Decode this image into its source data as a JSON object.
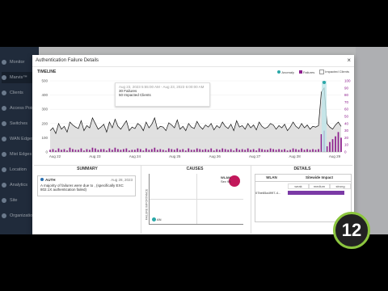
{
  "sidebar": {
    "items": [
      {
        "label": "Monitor"
      },
      {
        "label": "Marvis™"
      },
      {
        "label": "Clients"
      },
      {
        "label": "Access Points"
      },
      {
        "label": "Switches"
      },
      {
        "label": "WAN Edges"
      },
      {
        "label": "Mist Edges"
      },
      {
        "label": "Location"
      },
      {
        "label": "Analytics"
      },
      {
        "label": "Site"
      },
      {
        "label": "Organization"
      }
    ],
    "badge": "1"
  },
  "modal": {
    "title": "Authentication Failure Details",
    "close": "×"
  },
  "timeline": {
    "title": "TIMELINE",
    "legend": {
      "anomaly": "Anomaly",
      "failures": "Failures",
      "impacted": "Impacted Clients"
    },
    "tooltip": {
      "time": "Aug 23, 2023 5:55:00 AM - Aug 23, 2023 6:00:00 AM",
      "failures": "30 Failures",
      "clients": "50 Impacted Clients"
    }
  },
  "summary": {
    "title": "SUMMARY",
    "card_label": "AUTH",
    "card_date": "Aug 28, 2023",
    "card_text": "A majority of failures were due to , (specifically EXC 802.1X authentication failed)"
  },
  "causes": {
    "title": "CAUSES",
    "wlan_label": "WLAN",
    "wlan_value": "Sev 95",
    "axis_label": "FAILURE IMPORTANCE",
    "small_label": "AN"
  },
  "details": {
    "title": "DETAILS",
    "col_wlan": "WLAN",
    "col_impact": "Sitewide Impact",
    "sub_weak": "weak",
    "sub_medium": "medium",
    "sub_strong": "strong",
    "row_name": "07be65a4997-4..."
  },
  "player": {
    "badge": "12"
  },
  "colors": {
    "failures": "#8e1f8e",
    "impacted": "#d8d8d8",
    "anomaly": "#2aa7a7",
    "line": "#111111",
    "accent": "#7b3aa6"
  },
  "chart_data": {
    "type": "line",
    "title": "TIMELINE",
    "x_ticks": [
      "Aug 22",
      "Aug 23",
      "Aug 24",
      "Aug 25",
      "Aug 26",
      "Aug 27",
      "Aug 28",
      "Aug 29"
    ],
    "y_left_ticks": [
      0,
      100,
      200,
      300,
      400,
      500
    ],
    "y_right_ticks": [
      0,
      10,
      20,
      30,
      40,
      50,
      60,
      70,
      80,
      90,
      100
    ],
    "ylim_left": [
      0,
      500
    ],
    "ylim_right": [
      0,
      100
    ],
    "series": [
      {
        "name": "Impacted Clients",
        "axis": "left",
        "values": [
          150,
          170,
          130,
          200,
          160,
          180,
          140,
          210,
          190,
          175,
          165,
          220,
          150,
          185,
          170,
          240,
          200,
          160,
          175,
          195,
          140,
          210,
          170,
          230,
          180,
          160,
          190,
          220,
          150,
          175,
          165,
          200,
          185,
          150,
          210,
          170,
          195,
          240,
          160,
          180,
          175,
          150,
          205,
          190,
          170,
          225,
          160,
          180,
          150,
          200,
          175,
          165,
          215,
          180,
          160,
          190,
          175,
          200,
          155,
          185,
          170,
          210,
          180,
          165,
          195,
          150,
          220,
          175,
          185,
          160,
          200,
          170,
          190,
          155,
          210,
          180,
          165,
          175,
          200,
          190,
          160,
          185,
          170,
          195,
          150,
          175,
          210,
          180,
          165,
          200,
          170,
          190,
          160,
          180,
          175,
          185,
          420,
          450,
          200,
          175,
          160,
          190,
          210,
          180
        ]
      },
      {
        "name": "Failures",
        "axis": "right",
        "values": [
          3,
          4,
          2,
          5,
          3,
          4,
          2,
          6,
          4,
          3,
          3,
          5,
          2,
          4,
          3,
          6,
          5,
          3,
          4,
          4,
          2,
          5,
          3,
          6,
          4,
          3,
          4,
          5,
          2,
          3,
          3,
          5,
          4,
          2,
          5,
          3,
          4,
          6,
          3,
          4,
          3,
          2,
          5,
          4,
          3,
          5,
          3,
          4,
          2,
          5,
          3,
          3,
          5,
          4,
          3,
          4,
          3,
          5,
          2,
          4,
          3,
          5,
          4,
          3,
          4,
          2,
          5,
          3,
          4,
          3,
          5,
          3,
          4,
          2,
          5,
          4,
          3,
          3,
          5,
          4,
          3,
          4,
          3,
          4,
          2,
          3,
          5,
          4,
          3,
          5,
          3,
          4,
          3,
          4,
          3,
          4,
          25,
          30,
          8,
          14,
          18,
          22,
          28,
          20
        ]
      }
    ],
    "anomaly_index": 97
  }
}
